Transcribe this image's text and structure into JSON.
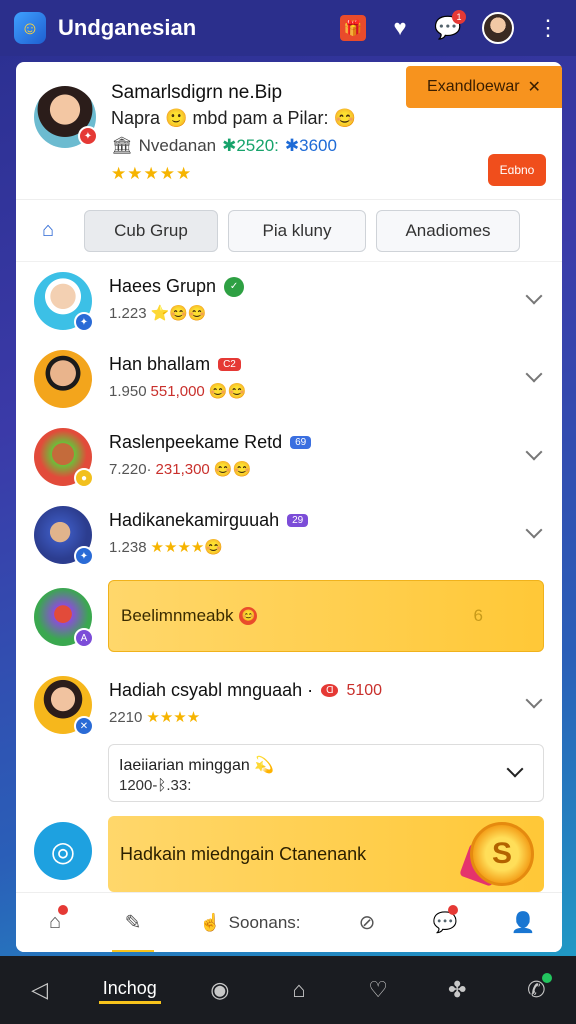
{
  "topbar": {
    "app_title": "Undganesian",
    "logo_icon": "app-logo-icon",
    "icons": [
      "gift-box-icon",
      "heart-icon",
      "chat-bubble-icon",
      "avatar",
      "more-vertical-icon"
    ],
    "notification_count": "1"
  },
  "profile": {
    "name": "Samarlsdigrn ne.Bip",
    "subtitle": "Napra 🙂 mbd pam a Pilar: 😊",
    "stats_label": "Nvedanan",
    "stats_green": "✱2520:",
    "stats_blue": "✱3600",
    "stars": "★★★★★",
    "expand_button": "Exandloewar",
    "expand_close": "✕",
    "orange_pill": "Eɑbno"
  },
  "tabs": {
    "home_icon": "home-icon",
    "items": [
      {
        "label": "Cub Grup",
        "active": true
      },
      {
        "label": "Pia kluny",
        "active": false
      },
      {
        "label": "Anadiomes",
        "active": false
      }
    ]
  },
  "list": [
    {
      "name": "Haees Grupn",
      "badge": "✓",
      "badge_type": "green",
      "sub": "1.223",
      "sub_suffix": "⭐😊😊",
      "sub_style": "coins"
    },
    {
      "name": "Han bhallam",
      "badge": "C2",
      "badge_type": "red",
      "sub": "1.950",
      "sub_red": "551,000",
      "sub_suffix": "😊😊",
      "sub_style": "coins"
    },
    {
      "name": "Raslenpeekame Retd",
      "badge": "69",
      "badge_type": "blue",
      "sub": "7.220·",
      "sub_red": "231,300",
      "sub_suffix": "😊😊",
      "sub_style": "coins"
    },
    {
      "name": "Hadikanekamirguuah",
      "badge": "29",
      "badge_type": "purple",
      "sub": "1.238",
      "sub_suffix": "★★★★😊",
      "sub_style": "stars"
    }
  ],
  "highlight": {
    "label": "Beelimnmeabk",
    "emoji": "😊",
    "extra": "6"
  },
  "row5": {
    "name": "Hadiah csyabl mnguaah ·",
    "badge": "Ɑ",
    "badge_red_text": "5100",
    "sub": "2210",
    "sub_suffix": "★★★★"
  },
  "sub_card": {
    "line1": "Iaeiiarian minggan 💫",
    "line2": "1200-ᛒ.33:"
  },
  "promo": {
    "label": "Hadkain miedngain Ctanenank",
    "coin": "S"
  },
  "bottom_nav": {
    "items": [
      "home-icon",
      "pencil-icon",
      "search-icon",
      "compass-icon",
      "chat-icon",
      "profile-icon"
    ],
    "search_label": "Soonans:"
  },
  "system_nav": {
    "active_label": "Inchog"
  }
}
